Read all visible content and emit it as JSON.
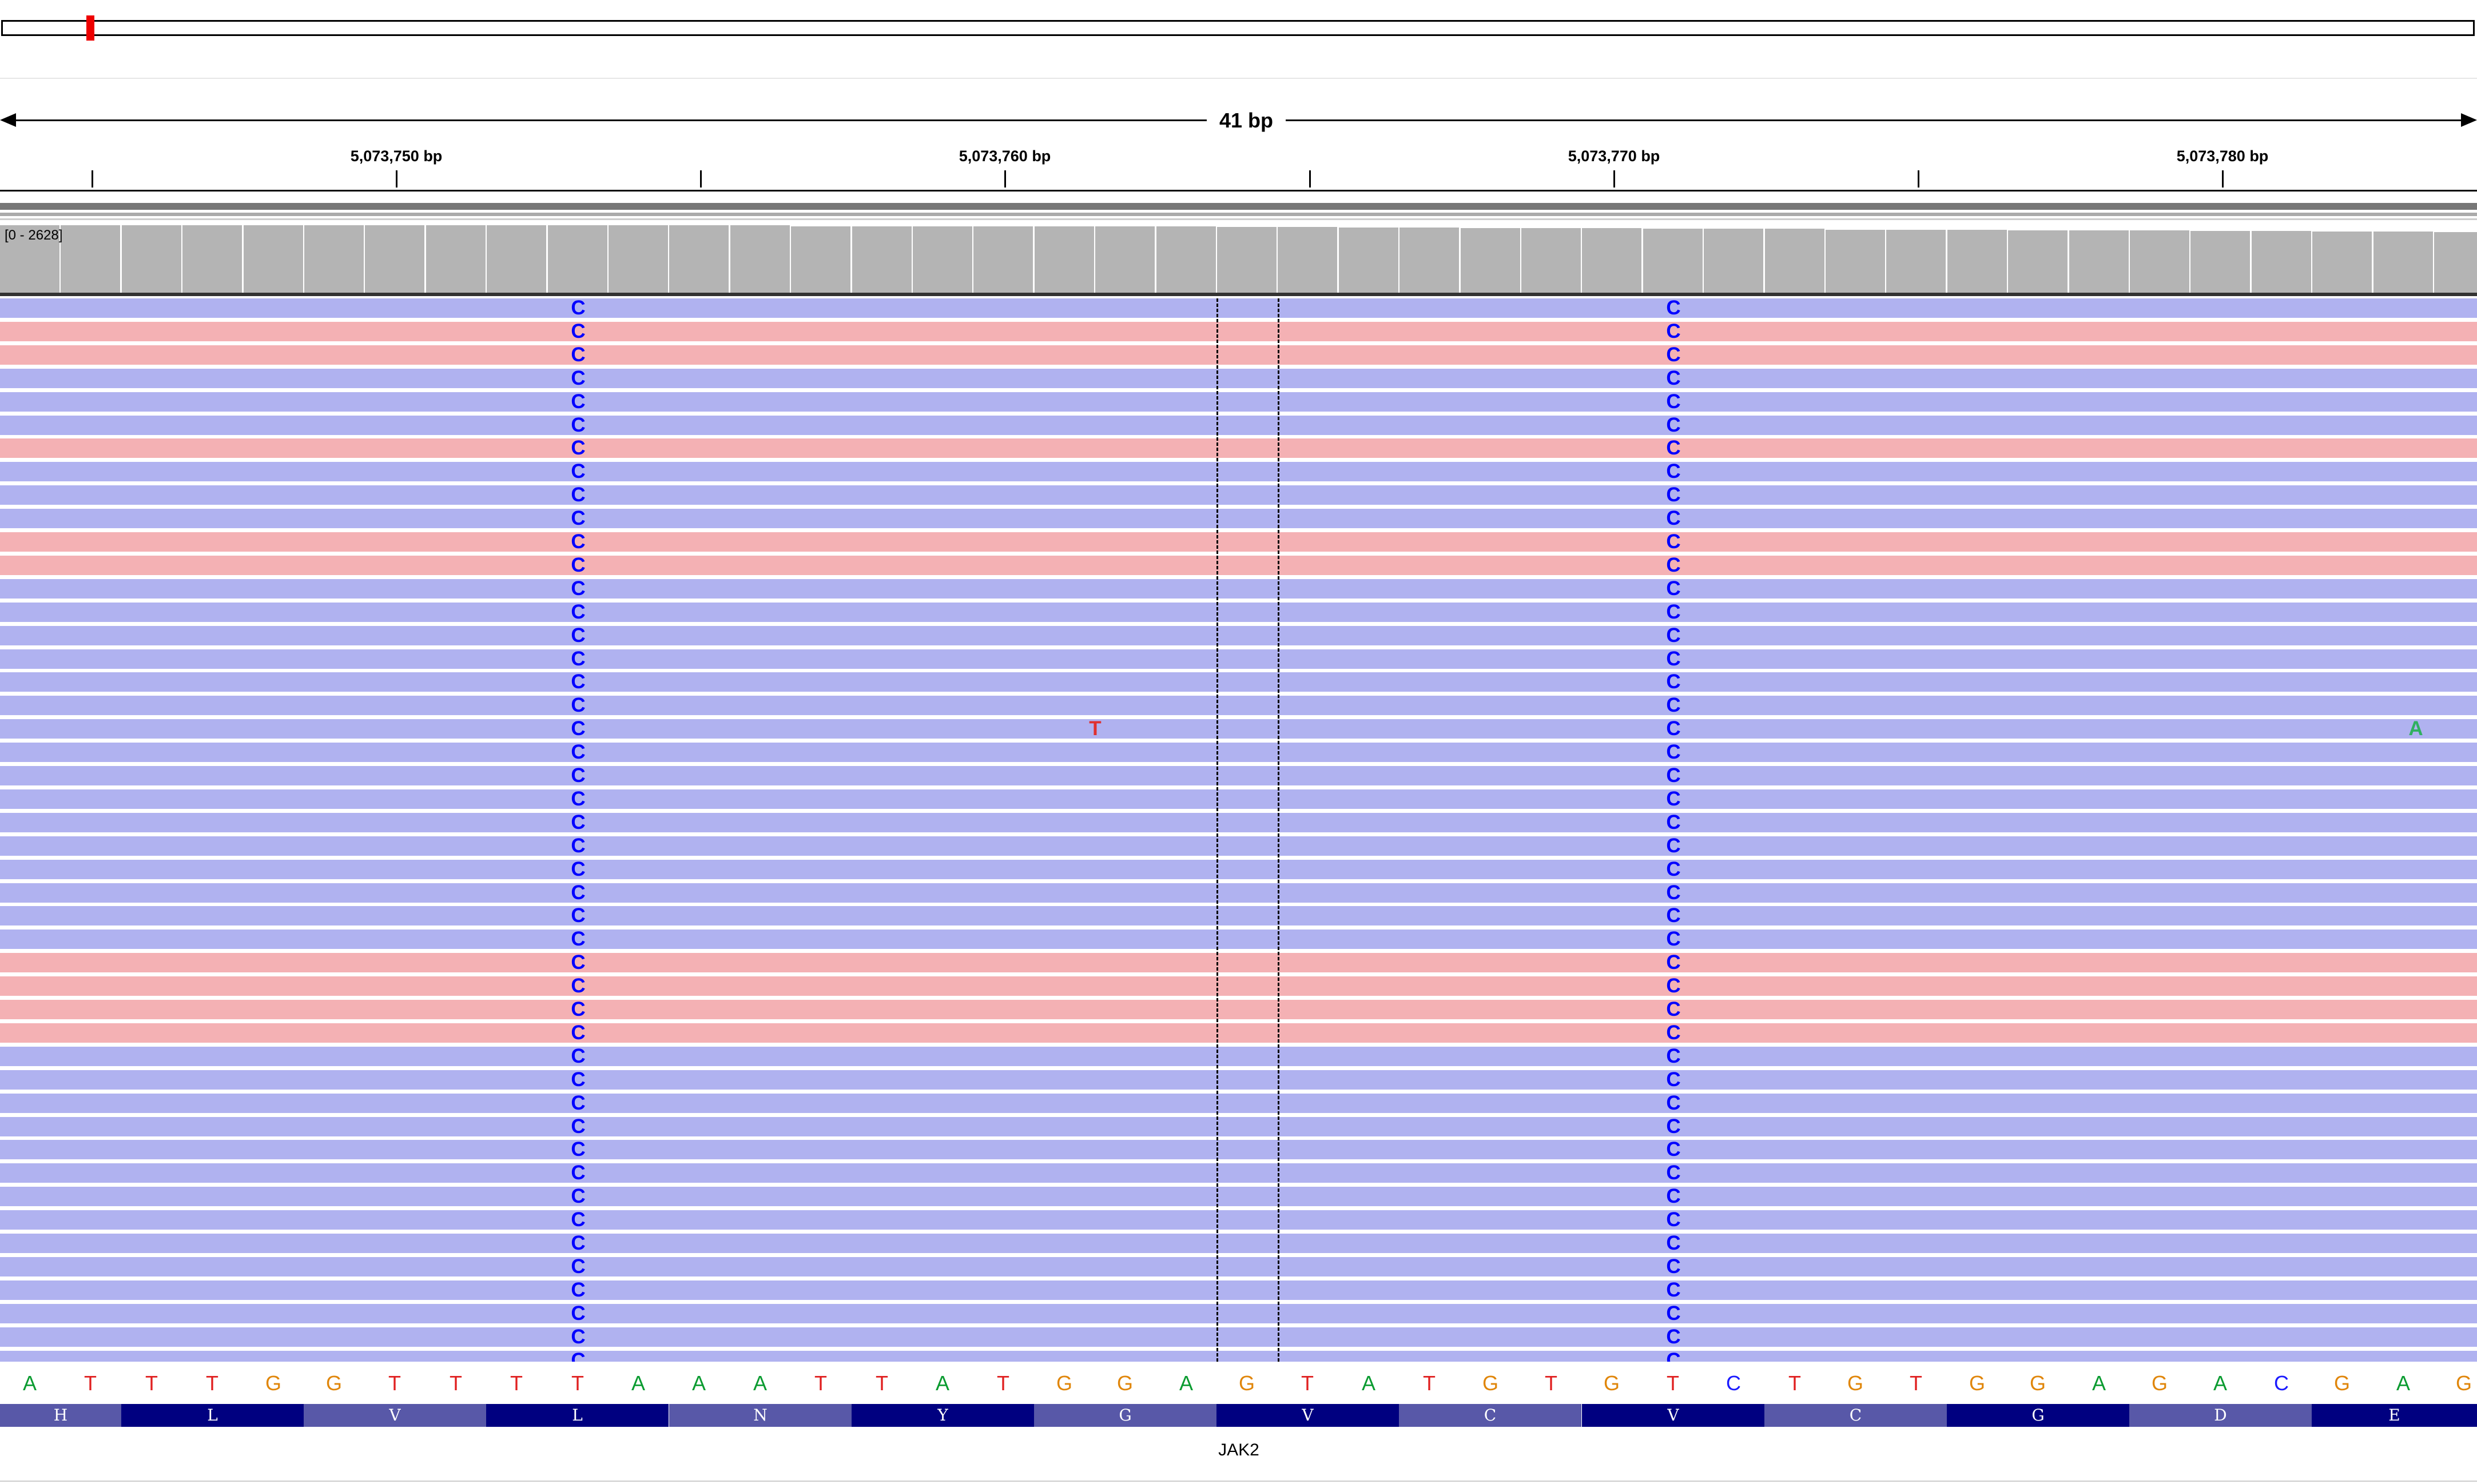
{
  "colors": {
    "forward_read": "#b0b2f0",
    "reverse_read": "#f4b1b4",
    "coverage": "#b4b4b4",
    "mismatch_C": "#0000ff",
    "mismatch_T": "#e03030",
    "mismatch_A": "#30b060",
    "A": "#0a9b30",
    "C": "#1a1aff",
    "G": "#e0860a",
    "T": "#e02020",
    "aa_dark": "#000080",
    "aa_light": "#5858a8"
  },
  "ruler": {
    "span_label": "41 bp",
    "ticks": [
      "5,073,750 bp",
      "5,073,760 bp",
      "5,073,770 bp",
      "5,073,780 bp"
    ]
  },
  "coverage": {
    "range_label": "[0 - 2628]",
    "levels": [
      0.98,
      0.98,
      0.98,
      0.98,
      0.98,
      0.98,
      0.98,
      0.98,
      0.98,
      0.98,
      0.98,
      0.98,
      0.98,
      0.97,
      0.97,
      0.97,
      0.97,
      0.97,
      0.97,
      0.97,
      0.96,
      0.96,
      0.95,
      0.95,
      0.94,
      0.94,
      0.94,
      0.93,
      0.93,
      0.93,
      0.92,
      0.92,
      0.92,
      0.91,
      0.91,
      0.91,
      0.9,
      0.9,
      0.89,
      0.89,
      0.88
    ]
  },
  "reads": {
    "strands": [
      "F",
      "R",
      "R",
      "F",
      "F",
      "F",
      "R",
      "F",
      "F",
      "F",
      "R",
      "R",
      "F",
      "F",
      "F",
      "F",
      "F",
      "F",
      "F",
      "F",
      "F",
      "F",
      "F",
      "F",
      "F",
      "F",
      "F",
      "F",
      "R",
      "R",
      "R",
      "R",
      "F",
      "F",
      "F",
      "F",
      "F",
      "F",
      "F",
      "F",
      "F",
      "F",
      "F",
      "F",
      "F",
      "F",
      "F"
    ],
    "mismatch_base_1": "C",
    "mismatch_base_2": "C",
    "extra_mismatches": [
      {
        "row": 18,
        "base": "T"
      },
      {
        "row": 18,
        "base": "A"
      }
    ]
  },
  "reference_sequence": [
    "A",
    "T",
    "T",
    "T",
    "G",
    "G",
    "T",
    "T",
    "T",
    "T",
    "A",
    "A",
    "A",
    "T",
    "T",
    "A",
    "T",
    "G",
    "G",
    "A",
    "G",
    "T",
    "A",
    "T",
    "G",
    "T",
    "G",
    "T",
    "C",
    "T",
    "G",
    "T",
    "G",
    "G",
    "A",
    "G",
    "A",
    "C",
    "G",
    "A",
    "G"
  ],
  "amino_acids": [
    "H",
    "L",
    "V",
    "L",
    "N",
    "Y",
    "G",
    "V",
    "C",
    "V",
    "C",
    "G",
    "D",
    "E"
  ],
  "gene": {
    "name": "JAK2"
  }
}
